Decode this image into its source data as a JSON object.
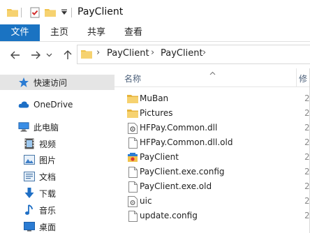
{
  "window": {
    "title": "PayClient"
  },
  "ribbon": {
    "tabs": [
      {
        "label": "文件"
      },
      {
        "label": "主页"
      },
      {
        "label": "共享"
      },
      {
        "label": "查看"
      }
    ]
  },
  "address": {
    "crumbs": [
      "PayClient",
      "PayClient"
    ]
  },
  "sidebar": {
    "items": [
      {
        "label": "快速访问",
        "icon": "star-icon"
      },
      {
        "label": "OneDrive",
        "icon": "cloud-icon"
      },
      {
        "label": "此电脑",
        "icon": "computer-icon"
      },
      {
        "label": "视频",
        "icon": "video-icon"
      },
      {
        "label": "图片",
        "icon": "pictures-icon"
      },
      {
        "label": "文档",
        "icon": "documents-icon"
      },
      {
        "label": "下载",
        "icon": "download-icon"
      },
      {
        "label": "音乐",
        "icon": "music-icon"
      },
      {
        "label": "桌面",
        "icon": "desktop-icon"
      }
    ]
  },
  "files": {
    "column_name": "名称",
    "column_date_partial": "修",
    "date_partial": "2",
    "rows": [
      {
        "name": "MuBan",
        "type": "folder"
      },
      {
        "name": "Pictures",
        "type": "folder"
      },
      {
        "name": "HFPay.Common.dll",
        "type": "dll"
      },
      {
        "name": "HFPay.Common.dll.old",
        "type": "file"
      },
      {
        "name": "PayClient",
        "type": "exe"
      },
      {
        "name": "PayClient.exe.config",
        "type": "file"
      },
      {
        "name": "PayClient.exe.old",
        "type": "file"
      },
      {
        "name": "uic",
        "type": "settings"
      },
      {
        "name": "update.config",
        "type": "file"
      }
    ]
  },
  "colors": {
    "accent": "#1a73c2",
    "folder": "#f1c34b",
    "selection": "#e5e5e5"
  }
}
